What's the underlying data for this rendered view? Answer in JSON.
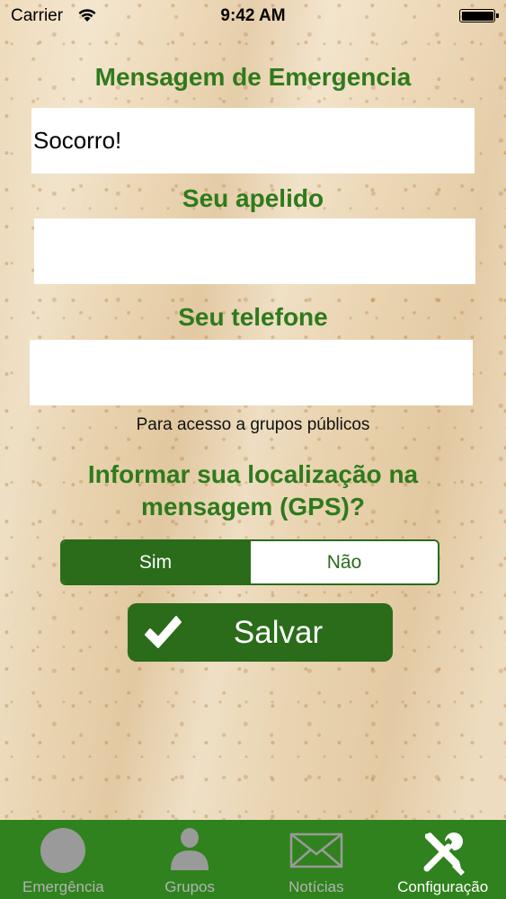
{
  "status_bar": {
    "carrier": "Carrier",
    "time": "9:42 AM"
  },
  "form": {
    "message_heading": "Mensagem de Emergencia",
    "message_value": "Socorro!",
    "nickname_heading": "Seu apelido",
    "nickname_value": "",
    "phone_heading": "Seu telefone",
    "phone_value": "",
    "phone_hint": "Para acesso a grupos públicos",
    "gps_question_line1": "Informar sua localização na",
    "gps_question_line2": "mensagem (GPS)?",
    "gps_options": [
      "Sim",
      "Não"
    ],
    "gps_selected": "Sim",
    "save_label": "Salvar"
  },
  "tab_bar": {
    "tabs": [
      {
        "label": "Emergência",
        "icon": "circle-icon"
      },
      {
        "label": "Grupos",
        "icon": "person-icon"
      },
      {
        "label": "Notícias",
        "icon": "envelope-icon"
      },
      {
        "label": "Configuração",
        "icon": "tools-icon"
      }
    ],
    "active": "Configuração"
  },
  "colors": {
    "accent_green": "#2e7a1c",
    "button_green": "#2a6c1a",
    "tab_bar_green": "#2f821d",
    "inactive_tab": "#b4b4b4"
  }
}
